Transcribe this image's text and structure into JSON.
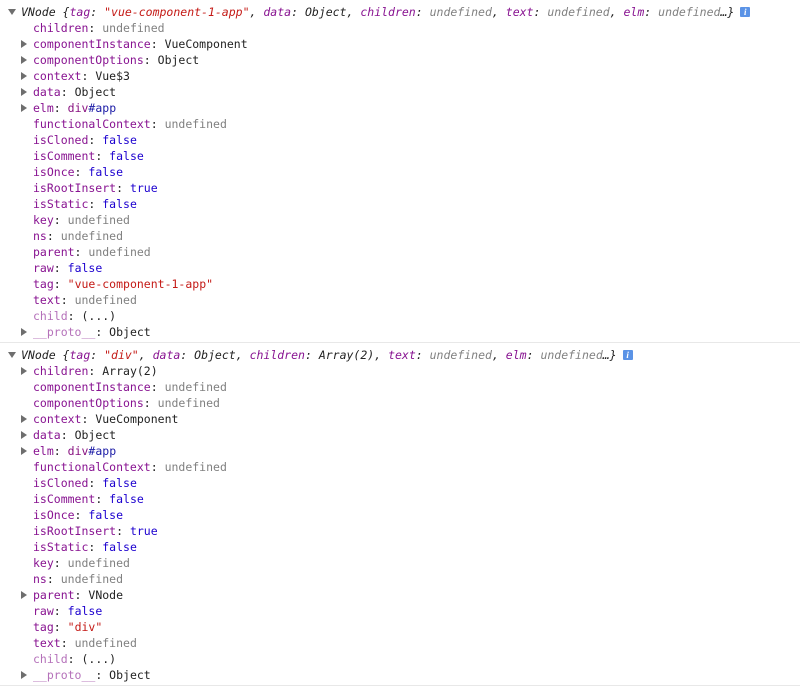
{
  "entries": [
    {
      "summary": {
        "prefix": "VNode {",
        "parts": [
          {
            "k": "tag",
            "v": "\"vue-component-1-app\"",
            "t": "str"
          },
          {
            "k": "data",
            "v": "Object",
            "t": "val"
          },
          {
            "k": "children",
            "v": "undefined",
            "t": "undef"
          },
          {
            "k": "text",
            "v": "undefined",
            "t": "undef"
          },
          {
            "k": "elm",
            "v": "undefined",
            "t": "undef"
          }
        ],
        "suffix": "…}"
      },
      "props": [
        {
          "key": "children",
          "value": "undefined",
          "type": "undef",
          "expandable": false
        },
        {
          "key": "componentInstance",
          "value": "VueComponent",
          "type": "val",
          "expandable": true
        },
        {
          "key": "componentOptions",
          "value": "Object",
          "type": "val",
          "expandable": true
        },
        {
          "key": "context",
          "value": "Vue$3",
          "type": "val",
          "expandable": true
        },
        {
          "key": "data",
          "value": "Object",
          "type": "val",
          "expandable": true
        },
        {
          "key": "elm",
          "value": "div",
          "hash": "#app",
          "type": "dom",
          "expandable": true
        },
        {
          "key": "functionalContext",
          "value": "undefined",
          "type": "undef",
          "expandable": false
        },
        {
          "key": "isCloned",
          "value": "false",
          "type": "bool",
          "expandable": false
        },
        {
          "key": "isComment",
          "value": "false",
          "type": "bool",
          "expandable": false
        },
        {
          "key": "isOnce",
          "value": "false",
          "type": "bool",
          "expandable": false
        },
        {
          "key": "isRootInsert",
          "value": "true",
          "type": "bool",
          "expandable": false
        },
        {
          "key": "isStatic",
          "value": "false",
          "type": "bool",
          "expandable": false
        },
        {
          "key": "key",
          "value": "undefined",
          "type": "undef",
          "expandable": false
        },
        {
          "key": "ns",
          "value": "undefined",
          "type": "undef",
          "expandable": false
        },
        {
          "key": "parent",
          "value": "undefined",
          "type": "undef",
          "expandable": false
        },
        {
          "key": "raw",
          "value": "false",
          "type": "bool",
          "expandable": false
        },
        {
          "key": "tag",
          "value": "\"vue-component-1-app\"",
          "type": "str",
          "expandable": false
        },
        {
          "key": "text",
          "value": "undefined",
          "type": "undef",
          "expandable": false
        },
        {
          "key": "child",
          "value": "(...)",
          "type": "val",
          "expandable": false,
          "getter": true
        },
        {
          "key": "__proto__",
          "value": "Object",
          "type": "val",
          "expandable": true,
          "proto": true
        }
      ]
    },
    {
      "summary": {
        "prefix": "VNode {",
        "parts": [
          {
            "k": "tag",
            "v": "\"div\"",
            "t": "str"
          },
          {
            "k": "data",
            "v": "Object",
            "t": "val"
          },
          {
            "k": "children",
            "v": "Array(2)",
            "t": "val"
          },
          {
            "k": "text",
            "v": "undefined",
            "t": "undef"
          },
          {
            "k": "elm",
            "v": "undefined",
            "t": "undef"
          }
        ],
        "suffix": "…}"
      },
      "props": [
        {
          "key": "children",
          "value": "Array(2)",
          "type": "val",
          "expandable": true
        },
        {
          "key": "componentInstance",
          "value": "undefined",
          "type": "undef",
          "expandable": false
        },
        {
          "key": "componentOptions",
          "value": "undefined",
          "type": "undef",
          "expandable": false
        },
        {
          "key": "context",
          "value": "VueComponent",
          "type": "val",
          "expandable": true
        },
        {
          "key": "data",
          "value": "Object",
          "type": "val",
          "expandable": true
        },
        {
          "key": "elm",
          "value": "div",
          "hash": "#app",
          "type": "dom",
          "expandable": true
        },
        {
          "key": "functionalContext",
          "value": "undefined",
          "type": "undef",
          "expandable": false
        },
        {
          "key": "isCloned",
          "value": "false",
          "type": "bool",
          "expandable": false
        },
        {
          "key": "isComment",
          "value": "false",
          "type": "bool",
          "expandable": false
        },
        {
          "key": "isOnce",
          "value": "false",
          "type": "bool",
          "expandable": false
        },
        {
          "key": "isRootInsert",
          "value": "true",
          "type": "bool",
          "expandable": false
        },
        {
          "key": "isStatic",
          "value": "false",
          "type": "bool",
          "expandable": false
        },
        {
          "key": "key",
          "value": "undefined",
          "type": "undef",
          "expandable": false
        },
        {
          "key": "ns",
          "value": "undefined",
          "type": "undef",
          "expandable": false
        },
        {
          "key": "parent",
          "value": "VNode",
          "type": "val",
          "expandable": true
        },
        {
          "key": "raw",
          "value": "false",
          "type": "bool",
          "expandable": false
        },
        {
          "key": "tag",
          "value": "\"div\"",
          "type": "str",
          "expandable": false
        },
        {
          "key": "text",
          "value": "undefined",
          "type": "undef",
          "expandable": false
        },
        {
          "key": "child",
          "value": "(...)",
          "type": "val",
          "expandable": false,
          "getter": true
        },
        {
          "key": "__proto__",
          "value": "Object",
          "type": "val",
          "expandable": true,
          "proto": true
        }
      ]
    }
  ],
  "info_icon_glyph": "i",
  "colors": {
    "key": "#881391",
    "string": "#c41a16",
    "boolean": "#1c00cf",
    "undefined": "#808080",
    "info_icon": "#5b93e6"
  }
}
